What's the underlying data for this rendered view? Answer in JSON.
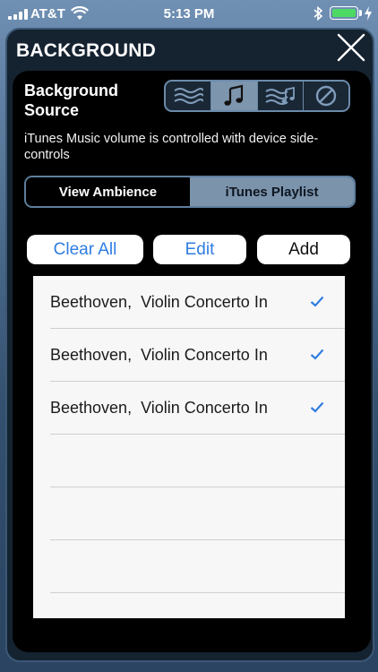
{
  "status_bar": {
    "carrier": "AT&T",
    "time": "5:13 PM"
  },
  "panel": {
    "title": "BACKGROUND"
  },
  "source": {
    "label": "Background Source",
    "options": [
      "waves-icon",
      "music-note-icon",
      "waves-music-icon",
      "none-icon"
    ],
    "selected_index": 1
  },
  "description": "iTunes Music volume is controlled with device side-controls",
  "mode_tabs": {
    "view_ambience": "View Ambience",
    "itunes_playlist": "iTunes Playlist",
    "selected": "iTunes Playlist"
  },
  "actions": {
    "clear_all": "Clear All",
    "edit": "Edit",
    "add": "Add"
  },
  "playlist": {
    "rows": [
      {
        "title": "Beethoven,  Violin Concerto In",
        "checked": true
      },
      {
        "title": "Beethoven,  Violin Concerto In",
        "checked": true
      },
      {
        "title": "Beethoven,  Violin Concerto In",
        "checked": true
      }
    ]
  },
  "colors": {
    "accent_blue": "#2f7de1",
    "selected_segment": "#7b93ab",
    "battery_green": "#4cd964"
  }
}
